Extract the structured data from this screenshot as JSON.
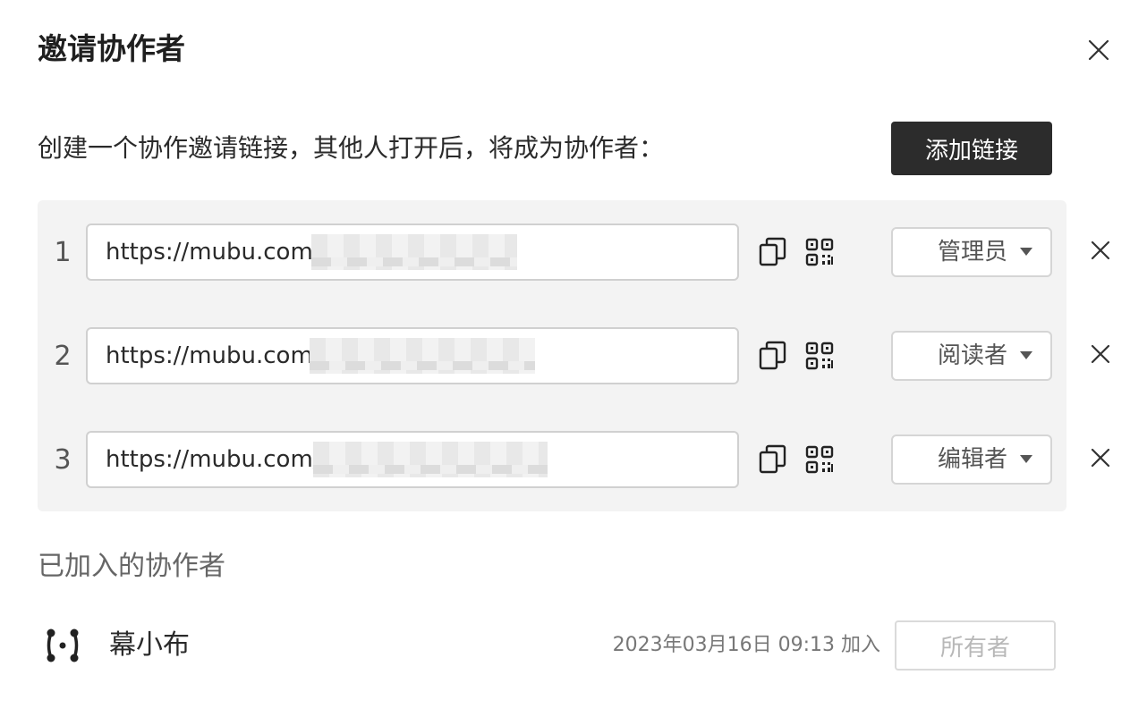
{
  "dialog": {
    "title": "邀请协作者",
    "close_icon": "close-icon"
  },
  "invite": {
    "description": "创建一个协作邀请链接，其他人打开后，将成为协作者：",
    "add_link_label": "添加链接"
  },
  "links": [
    {
      "index": "1",
      "url": "https://mubu.com/",
      "role": "管理员",
      "copy_icon": "copy-icon",
      "qr_icon": "qrcode-icon",
      "remove_icon": "close-icon"
    },
    {
      "index": "2",
      "url": "https://mubu.com",
      "role": "阅读者",
      "copy_icon": "copy-icon",
      "qr_icon": "qrcode-icon",
      "remove_icon": "close-icon"
    },
    {
      "index": "3",
      "url": "https://mubu.com/",
      "role": "编辑者",
      "copy_icon": "copy-icon",
      "qr_icon": "qrcode-icon",
      "remove_icon": "close-icon"
    }
  ],
  "joined": {
    "title": "已加入的协作者",
    "members": [
      {
        "name": "幕小布",
        "joined_text": "2023年03月16日 09:13 加入",
        "role": "所有者",
        "avatar_icon": "mubu-logo-icon"
      }
    ]
  }
}
